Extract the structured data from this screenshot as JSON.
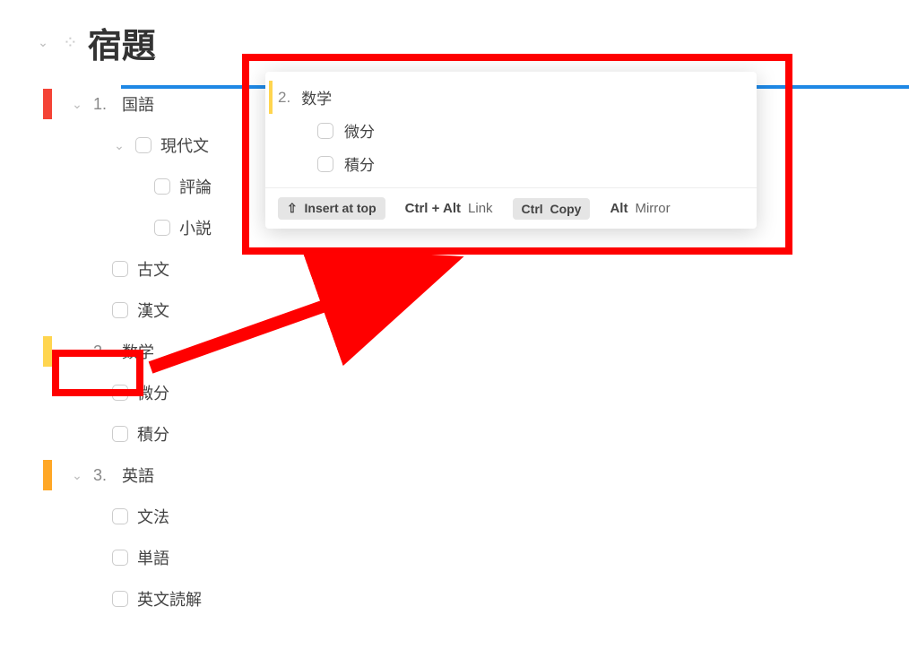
{
  "title": "宿題",
  "outline": {
    "items": [
      {
        "num": "1.",
        "label": "国語",
        "bar": "red",
        "children": [
          {
            "label": "現代文",
            "checkbox": true,
            "expandable": true,
            "children": [
              {
                "label": "評論",
                "checkbox": true
              },
              {
                "label": "小説",
                "checkbox": true
              }
            ]
          },
          {
            "label": "古文",
            "checkbox": true
          },
          {
            "label": "漢文",
            "checkbox": true
          }
        ]
      },
      {
        "num": "2.",
        "label": "数学",
        "bar": "yellow",
        "children": [
          {
            "label": "微分",
            "checkbox": true
          },
          {
            "label": "積分",
            "checkbox": true
          }
        ]
      },
      {
        "num": "3.",
        "label": "英語",
        "bar": "orange",
        "children": [
          {
            "label": "文法",
            "checkbox": true
          },
          {
            "label": "単語",
            "checkbox": true
          },
          {
            "label": "英文読解",
            "checkbox": true
          }
        ]
      }
    ]
  },
  "popup": {
    "num": "2.",
    "label": "数学",
    "children": [
      {
        "label": "微分"
      },
      {
        "label": "積分"
      }
    ],
    "actions": {
      "insert": {
        "key_icon": "⇧",
        "label": "Insert at top"
      },
      "link": {
        "keys": "Ctrl + Alt",
        "label": "Link"
      },
      "copy": {
        "keys": "Ctrl",
        "label": "Copy"
      },
      "mirror": {
        "keys": "Alt",
        "label": "Mirror"
      }
    }
  }
}
